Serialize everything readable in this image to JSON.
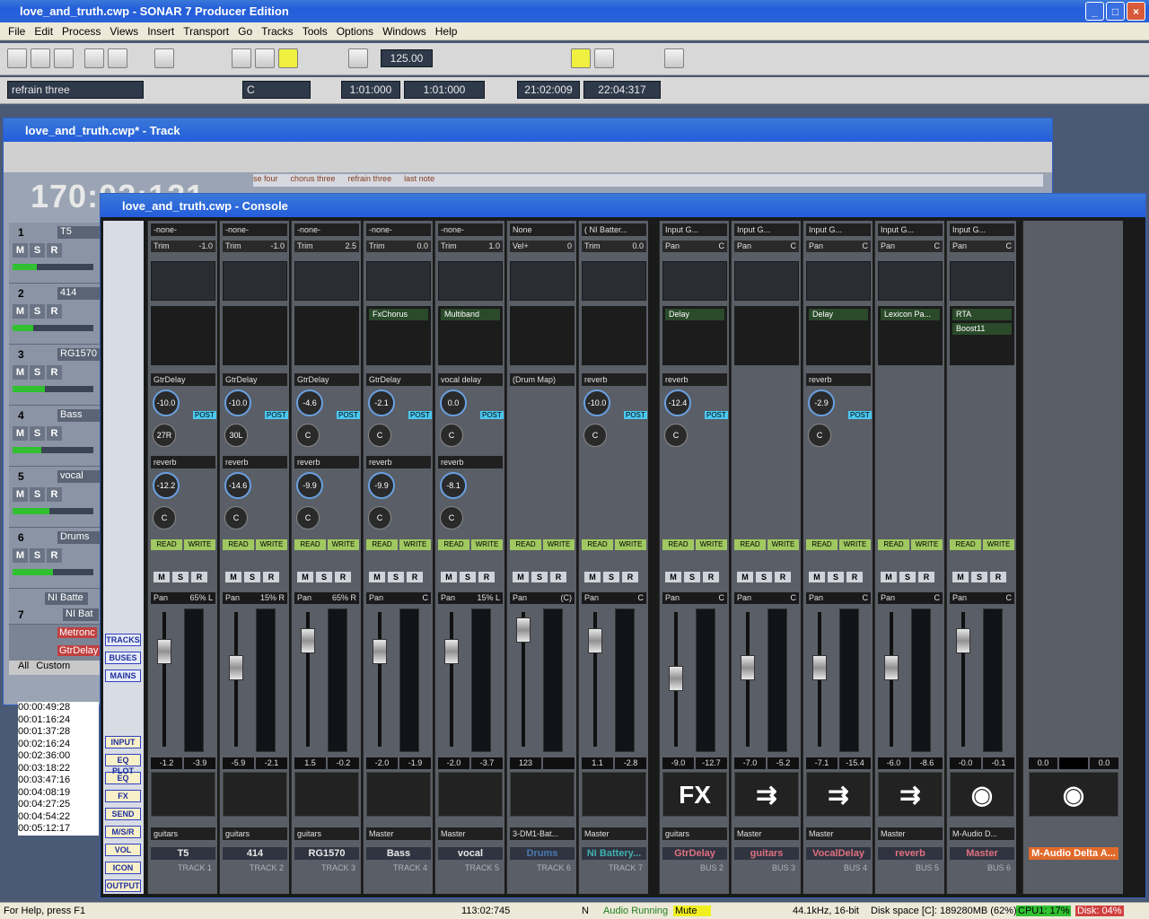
{
  "app": {
    "title": "love_and_truth.cwp - SONAR 7 Producer Edition"
  },
  "menu": [
    "File",
    "Edit",
    "Process",
    "Views",
    "Insert",
    "Transport",
    "Go",
    "Tracks",
    "Tools",
    "Options",
    "Windows",
    "Help"
  ],
  "toolbar": {
    "tempo": "125.00",
    "marker": "refrain three",
    "key": "C",
    "from": "1:01:000",
    "thru": "1:01:000",
    "sel_start": "21:02:009",
    "sel_end": "22:04:317"
  },
  "track_window": {
    "title": "love_and_truth.cwp* - Track",
    "time": "170:02:121",
    "markers": [
      "se four",
      "chorus three",
      "refrain three",
      "last note"
    ],
    "tracks": [
      {
        "num": "1",
        "name": "T5",
        "pan": "65% L",
        "vol": 0.3
      },
      {
        "num": "2",
        "name": "414",
        "pan": "15% R",
        "vol": 0.25
      },
      {
        "num": "3",
        "name": "RG1570",
        "pan": "65% R",
        "vol": 0.4
      },
      {
        "num": "4",
        "name": "Bass",
        "pan": "C",
        "vol": 0.35
      },
      {
        "num": "5",
        "name": "vocal",
        "pan": "15% L",
        "vol": 0.45
      },
      {
        "num": "6",
        "name": "Drums",
        "pan": "(C)",
        "vol": 0.5
      }
    ],
    "folder": "NI Batte",
    "track7": {
      "num": "7",
      "name": "NI Bat"
    },
    "extra": [
      "Metronc",
      "GtrDelay"
    ],
    "tabs": [
      "All",
      "Custom"
    ]
  },
  "times": [
    "00:00:49:28",
    "00:01:16:24",
    "00:01:37:28",
    "00:02:16:24",
    "00:02:36:00",
    "00:03:18:22",
    "00:03:47:16",
    "00:04:08:19",
    "00:04:27:25",
    "00:04:54:22",
    "00:05:12:17"
  ],
  "console": {
    "title": "love_and_truth.cwp - Console",
    "side_buttons": [
      "TRACKS",
      "BUSES",
      "MAINS"
    ],
    "side_buttons2": [
      "INPUT",
      "EQ PLOT",
      "EQ",
      "FX",
      "SEND",
      "M/S/R",
      "VOL",
      "ICON",
      "OUTPUT"
    ],
    "strips": [
      {
        "input": "-none-",
        "trim_label": "Trim",
        "trim": "-1.0",
        "fx": [],
        "send1": "GtrDelay",
        "send1_lev": "-10.0",
        "send1_pan": "27R",
        "send2": "reverb",
        "send2_lev": "-12.2",
        "send2_pan": "C",
        "pan": "65% L",
        "fader": 0.25,
        "vl": "-1.2",
        "vr": "-3.9",
        "pic": "",
        "out": "guitars",
        "name": "T5",
        "id": "TRACK 1",
        "kind": "track"
      },
      {
        "input": "-none-",
        "trim_label": "Trim",
        "trim": "-1.0",
        "fx": [],
        "send1": "GtrDelay",
        "send1_lev": "-10.0",
        "send1_pan": "30L",
        "send2": "reverb",
        "send2_lev": "-14.6",
        "send2_pan": "C",
        "pan": "15% R",
        "fader": 0.4,
        "vl": "-5.9",
        "vr": "-2.1",
        "pic": "",
        "out": "guitars",
        "name": "414",
        "id": "TRACK 2",
        "kind": "track"
      },
      {
        "input": "-none-",
        "trim_label": "Trim",
        "trim": "2.5",
        "fx": [],
        "send1": "GtrDelay",
        "send1_lev": "-4.6",
        "send1_pan": "C",
        "send2": "reverb",
        "send2_lev": "-9.9",
        "send2_pan": "C",
        "pan": "65% R",
        "fader": 0.15,
        "vl": "1.5",
        "vr": "-0.2",
        "pic": "",
        "out": "guitars",
        "name": "RG1570",
        "id": "TRACK 3",
        "kind": "track"
      },
      {
        "input": "-none-",
        "trim_label": "Trim",
        "trim": "0.0",
        "fx": [
          "FxChorus"
        ],
        "send1": "GtrDelay",
        "send1_lev": "-2.1",
        "send1_pan": "C",
        "send2": "reverb",
        "send2_lev": "-9.9",
        "send2_pan": "C",
        "pan": "C",
        "fader": 0.25,
        "vl": "-2.0",
        "vr": "-1.9",
        "pic": "",
        "out": "Master",
        "name": "Bass",
        "id": "TRACK 4",
        "kind": "track"
      },
      {
        "input": "-none-",
        "trim_label": "Trim",
        "trim": "1.0",
        "fx": [
          "Multiband"
        ],
        "send1": "vocal delay",
        "send1_lev": "0.0",
        "send1_pan": "C",
        "send2": "reverb",
        "send2_lev": "-8.1",
        "send2_pan": "C",
        "pan": "15% L",
        "fader": 0.25,
        "vl": "-2.0",
        "vr": "-3.7",
        "pic": "",
        "out": "Master",
        "name": "vocal",
        "id": "TRACK 5",
        "kind": "track"
      },
      {
        "input": "None",
        "trim_label": "Vel+",
        "trim": "0",
        "fx": [],
        "send1": "(Drum Map)",
        "send1_lev": "",
        "send1_pan": "",
        "send2": "",
        "send2_lev": "",
        "send2_pan": "",
        "pan": "(C)",
        "fader": 0.05,
        "vl": "123",
        "vr": "",
        "pic": "",
        "out": "3-DM1-Bat...",
        "name": "Drums",
        "id": "TRACK 6",
        "kind": "drum"
      },
      {
        "input": "( NI Batter...",
        "trim_label": "Trim",
        "trim": "0.0",
        "fx": [],
        "send1": "reverb",
        "send1_lev": "-10.0",
        "send1_pan": "C",
        "send2": "",
        "send2_lev": "",
        "send2_pan": "",
        "pan": "C",
        "fader": 0.15,
        "vl": "1.1",
        "vr": "-2.8",
        "pic": "",
        "out": "Master",
        "name": "NI Battery...",
        "id": "TRACK 7",
        "kind": "nib"
      },
      {
        "input": "Input G...",
        "trim_label": "Pan",
        "trim": "C",
        "fx": [
          "Delay"
        ],
        "send1": "reverb",
        "send1_lev": "-12.4",
        "send1_pan": "C",
        "send2": "",
        "send2_lev": "",
        "send2_pan": "",
        "pan": "C",
        "fader": 0.5,
        "vl": "-9.0",
        "vr": "-12.7",
        "pic": "FX",
        "out": "guitars",
        "name": "GtrDelay",
        "id": "BUS 2",
        "kind": "bus"
      },
      {
        "input": "Input G...",
        "trim_label": "Pan",
        "trim": "C",
        "fx": [],
        "send1": "",
        "send1_lev": "",
        "send1_pan": "",
        "send2": "",
        "send2_lev": "",
        "send2_pan": "",
        "pan": "C",
        "fader": 0.4,
        "vl": "-7.0",
        "vr": "-5.2",
        "pic": "⇉",
        "out": "Master",
        "name": "guitars",
        "id": "BUS 3",
        "kind": "bus"
      },
      {
        "input": "Input G...",
        "trim_label": "Pan",
        "trim": "C",
        "fx": [
          "Delay"
        ],
        "send1": "reverb",
        "send1_lev": "-2.9",
        "send1_pan": "C",
        "send2": "",
        "send2_lev": "",
        "send2_pan": "",
        "pan": "C",
        "fader": 0.4,
        "vl": "-7.1",
        "vr": "-15.4",
        "pic": "⇉",
        "out": "Master",
        "name": "VocalDelay",
        "id": "BUS 4",
        "kind": "bus"
      },
      {
        "input": "Input G...",
        "trim_label": "Pan",
        "trim": "C",
        "fx": [
          "Lexicon Pa..."
        ],
        "send1": "",
        "send1_lev": "",
        "send1_pan": "",
        "send2": "",
        "send2_lev": "",
        "send2_pan": "",
        "pan": "C",
        "fader": 0.4,
        "vl": "-6.0",
        "vr": "-8.6",
        "pic": "⇉",
        "out": "Master",
        "name": "reverb",
        "id": "BUS 5",
        "kind": "bus"
      },
      {
        "input": "Input G...",
        "trim_label": "Pan",
        "trim": "C",
        "fx": [
          "RTA",
          "Boost11"
        ],
        "send1": "",
        "send1_lev": "",
        "send1_pan": "",
        "send2": "",
        "send2_lev": "",
        "send2_pan": "",
        "pan": "C",
        "fader": 0.15,
        "vl": "-0.0",
        "vr": "-0.1",
        "pic": "◉",
        "out": "M-Audio D...",
        "name": "Master",
        "id": "BUS 6",
        "kind": "bus"
      }
    ],
    "main": {
      "name": "M-Audio Delta A...",
      "vl": "0.0",
      "vr": "0.0"
    },
    "labels": {
      "read": "READ",
      "write": "WRITE",
      "m": "M",
      "s": "S",
      "r": "R",
      "post": "POST",
      "lev": "LEV",
      "pan": "PAN"
    }
  },
  "status": {
    "help": "For Help, press F1",
    "time": "113:02:745",
    "n": "N",
    "audio": "Audio Running",
    "mute": "Mute",
    "format": "44.1kHz, 16-bit",
    "disk": "Disk space [C]: 189280MB (62%)",
    "cpu": "CPU1: 17%",
    "diskuse": "Disk: 04%"
  }
}
